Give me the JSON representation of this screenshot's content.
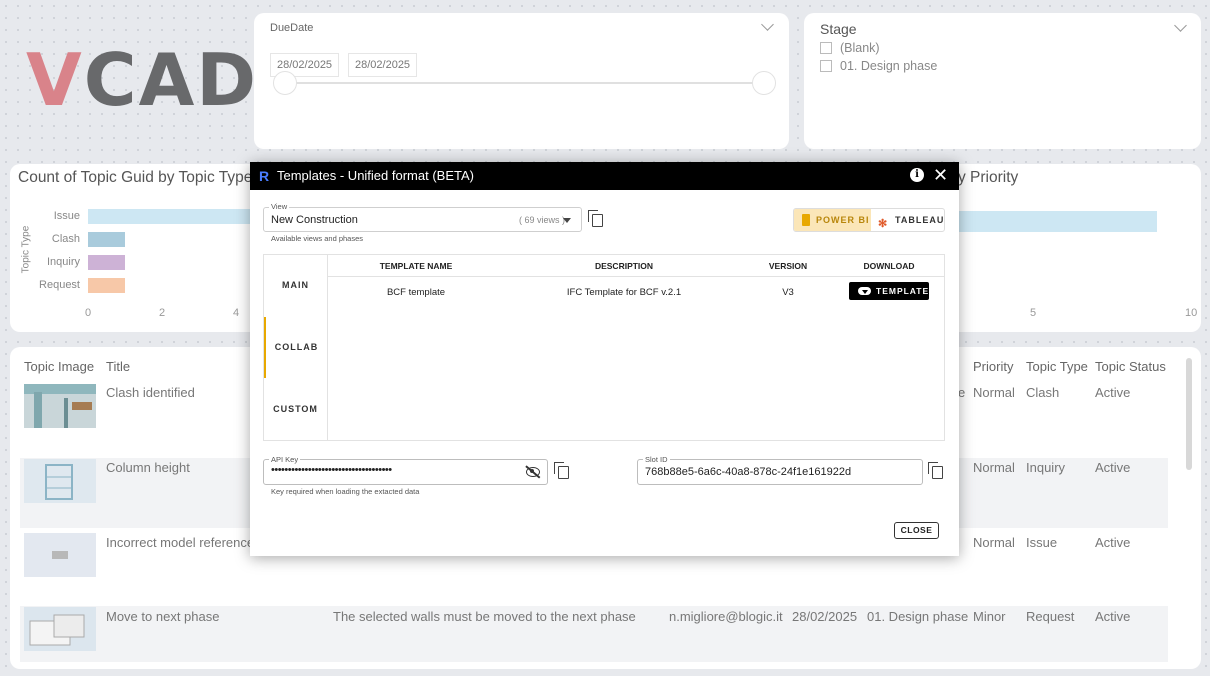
{
  "logo": {
    "v": "V",
    "rest": "CAD"
  },
  "duedate": {
    "title": "DueDate",
    "start": "28/02/2025",
    "end": "28/02/2025"
  },
  "stage": {
    "title": "Stage",
    "options": [
      "(Blank)",
      "01. Design phase"
    ]
  },
  "chart_left": {
    "title": "Count of Topic Guid by Topic Type",
    "ylabel": "Topic Type"
  },
  "chart_right": {
    "title_fragment": "y Priority"
  },
  "chart_data": [
    {
      "type": "bar",
      "orientation": "horizontal",
      "title": "Count of Topic Guid by Topic Type",
      "ylabel": "Topic Type",
      "categories": [
        "Issue",
        "Clash",
        "Inquiry",
        "Request"
      ],
      "values": [
        5,
        1,
        1,
        1
      ],
      "colors": [
        "#cde7f3",
        "#a9cbdc",
        "#cdb2d6",
        "#f7c8a8"
      ],
      "x_ticks": [
        "0",
        "2",
        "4"
      ],
      "xlim": [
        0,
        10
      ]
    },
    {
      "type": "bar",
      "orientation": "horizontal",
      "title": "y Priority",
      "values": [
        10
      ],
      "colors": [
        "#cde7f3"
      ],
      "x_ticks": [
        "5",
        "10"
      ],
      "xlim": [
        0,
        10
      ]
    }
  ],
  "table": {
    "headers": [
      "Topic Image",
      "Title",
      "Priority",
      "Topic Type",
      "Topic Status"
    ],
    "rows": [
      {
        "title": "Clash identified",
        "assignee_frag": "e",
        "priority": "Normal",
        "type": "Clash",
        "status": "Active"
      },
      {
        "title": "Column height",
        "priority": "Normal",
        "type": "Inquiry",
        "status": "Active"
      },
      {
        "title": "Incorrect model reference",
        "priority": "Normal",
        "type": "Issue",
        "status": "Active"
      },
      {
        "title": "Move to next phase",
        "description": "The selected walls must be moved to the next phase",
        "author": "n.migliore@blogic.it",
        "date": "28/02/2025",
        "stage": "01. Design phase",
        "priority": "Minor",
        "type": "Request",
        "status": "Active"
      }
    ]
  },
  "modal": {
    "logo": "R",
    "title": "Templates - Unified format (BETA)",
    "info": "i",
    "close": "✕",
    "view": {
      "label": "View",
      "value": "New Construction",
      "count": "( 69 views )",
      "helper": "Available views and phases"
    },
    "tools": {
      "powerbi": "POWER BI",
      "tableau": "TABLEAU"
    },
    "tabs": [
      "MAIN",
      "COLLAB",
      "CUSTOM"
    ],
    "columns": [
      "TEMPLATE NAME",
      "DESCRIPTION",
      "VERSION",
      "DOWNLOAD"
    ],
    "templates": [
      {
        "name": "BCF template",
        "description": "IFC Template for BCF v.2.1",
        "version": "V3",
        "download": "TEMPLATE"
      }
    ],
    "api_key": {
      "label": "API Key",
      "value": "••••••••••••••••••••••••••••••••••••",
      "helper": "Key required when loading the extacted data"
    },
    "slot_id": {
      "label": "Slot ID",
      "value": "768b88e5-6a6c-40a8-878c-24f1e161922d"
    },
    "close_button": "CLOSE"
  }
}
